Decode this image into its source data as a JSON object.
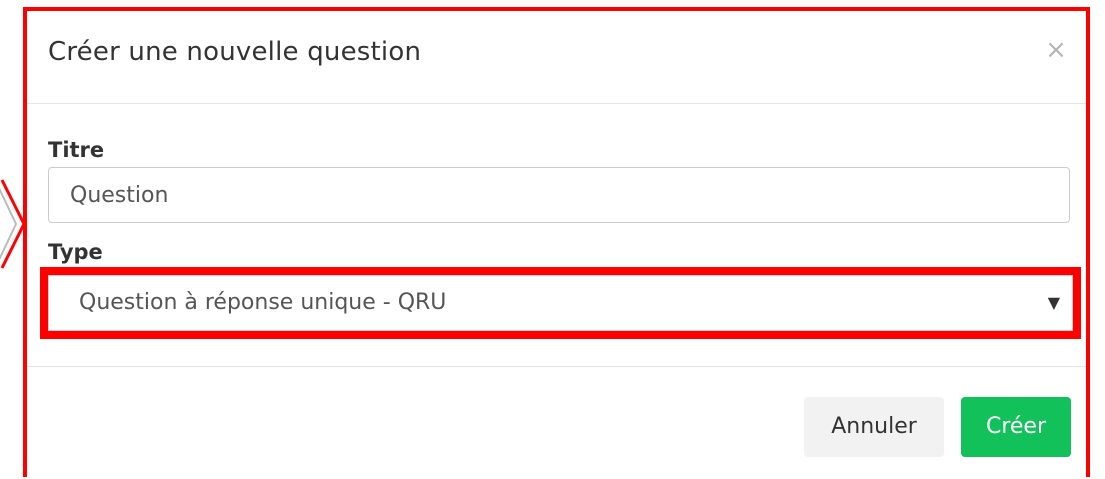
{
  "dialog": {
    "title": "Créer une nouvelle question",
    "close_label": "×"
  },
  "form": {
    "title_field": {
      "label": "Titre",
      "value": "Question"
    },
    "type_field": {
      "label": "Type",
      "selected": "Question à réponse unique - QRU",
      "arrow": "▼"
    }
  },
  "footer": {
    "cancel_label": "Annuler",
    "create_label": "Créer"
  },
  "colors": {
    "highlight": "#ff0000",
    "primary": "#13c15a",
    "secondary_button": "#f2f2f2"
  },
  "icons": {
    "close": "close-icon",
    "dropdown": "chevron-down-icon"
  }
}
